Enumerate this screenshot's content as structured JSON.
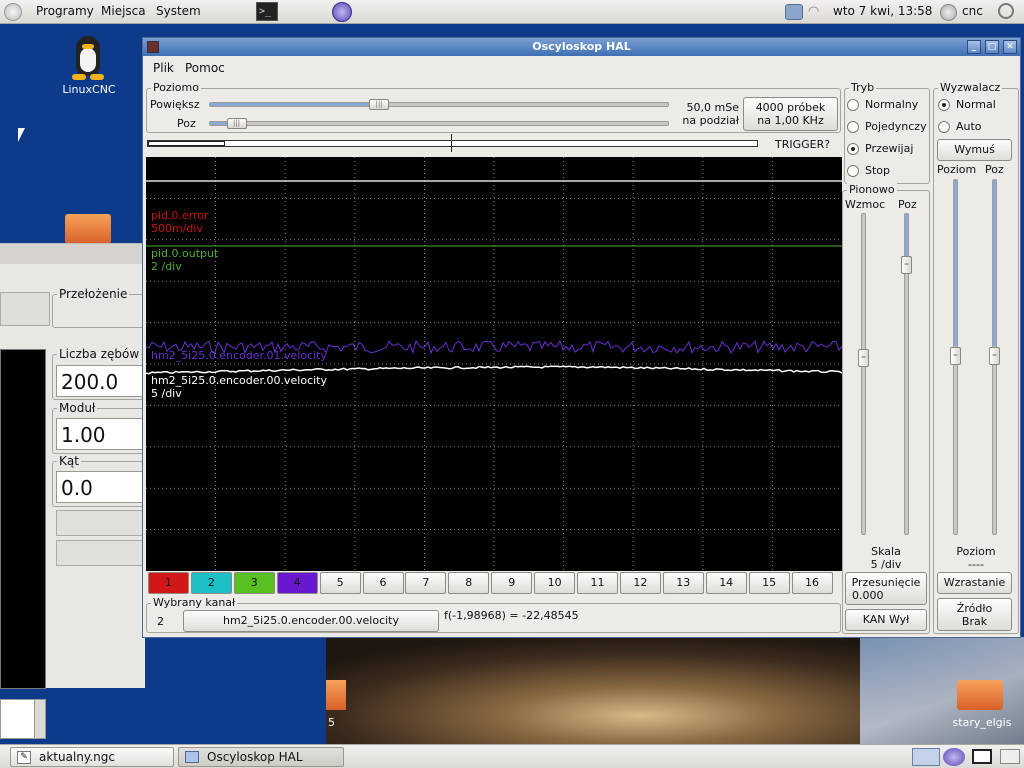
{
  "top_panel": {
    "menu": [
      "Programy",
      "Miejsca",
      "System"
    ],
    "clock": "wto  7 kwi, 13:58",
    "user": "cnc"
  },
  "desktop": {
    "icons": [
      {
        "label": "LinuxCNC",
        "icon": "linuxcnc-tux-icon"
      },
      {
        "label": "stary_elgis",
        "icon": "folder-icon"
      },
      {
        "label": "5",
        "icon": "folder-icon"
      }
    ]
  },
  "background_window": {
    "frames": {
      "przelozenie": "Przełożenie",
      "liczba_zebow": "Liczba zębów",
      "modul": "Moduł",
      "kat": "Kąt"
    },
    "values": {
      "liczba_zebow": "200.0",
      "modul": "1.00",
      "kat": "0.0"
    }
  },
  "window": {
    "title": "Oscyloskop HAL",
    "menu": [
      "Plik",
      "Pomoc"
    ],
    "horizontal": {
      "frame_label": "Poziomo",
      "zoom_label": "Powiększ",
      "pos_label": "Poz",
      "time_div_line1": "50,0 mSe",
      "time_div_line2": "na podział",
      "samples_line1": "4000 próbek",
      "samples_line2": "na 1,00 KHz",
      "trigger_label": "TRIGGER?",
      "zoom_level": 0.37,
      "pos_level": 0.06
    },
    "mode": {
      "frame_label": "Tryb",
      "options": [
        "Normalny",
        "Pojedynczy",
        "Przewijaj",
        "Stop"
      ],
      "selected": "Przewijaj"
    },
    "trigger": {
      "frame_label": "Wyzwalacz",
      "options": [
        "Normal",
        "Auto"
      ],
      "selected": "Normal",
      "force_label": "Wymuś",
      "level_label": "Poziom",
      "pos_label": "Poz",
      "level_title": "Poziom",
      "level_value": "----",
      "edge_label": "Wzrastanie",
      "source_line1": "Źródło",
      "source_line2": "Brak"
    },
    "vertical": {
      "frame_label": "Pionowo",
      "gain_label": "Wzmoc",
      "pos_label": "Poz",
      "scale_label": "Skala",
      "scale_value": "5 /div",
      "offset_label": "Przesunięcie",
      "offset_value": "0.000",
      "chan_off_label": "KAN Wył",
      "gain_level": 0.55,
      "pos_level": 0.16
    },
    "traces": [
      {
        "name": "pid.0.error",
        "scale": "500m/div",
        "color": "#c81414"
      },
      {
        "name": "pid.0.output",
        "scale": "2 /div",
        "color": "#4caf30"
      },
      {
        "name": "hm2_5i25.0.encoder.01.velocity",
        "scale": "",
        "color": "#6a2fd0"
      },
      {
        "name": "hm2_5i25.0.encoder.00.velocity",
        "scale": "5 /div",
        "color": "#ffffff"
      }
    ],
    "channels": [
      {
        "n": "1",
        "color": "#d01818"
      },
      {
        "n": "2",
        "color": "#1ec0c8"
      },
      {
        "n": "3",
        "color": "#58c020"
      },
      {
        "n": "4",
        "color": "#6a18d0"
      },
      {
        "n": "5",
        "color": ""
      },
      {
        "n": "6",
        "color": ""
      },
      {
        "n": "7",
        "color": ""
      },
      {
        "n": "8",
        "color": ""
      },
      {
        "n": "9",
        "color": ""
      },
      {
        "n": "10",
        "color": ""
      },
      {
        "n": "11",
        "color": ""
      },
      {
        "n": "12",
        "color": ""
      },
      {
        "n": "13",
        "color": ""
      },
      {
        "n": "14",
        "color": ""
      },
      {
        "n": "15",
        "color": ""
      },
      {
        "n": "16",
        "color": ""
      }
    ],
    "selected_channel": {
      "frame_label": "Wybrany kanał",
      "number": "2",
      "signal": "hm2_5i25.0.encoder.00.velocity",
      "readout": "f(-1,98968) = -22,48545"
    }
  },
  "taskbar": {
    "tasks": [
      {
        "label": "aktualny.ngc",
        "icon": "editor-icon"
      },
      {
        "label": "Oscyloskop HAL",
        "icon": "window-icon"
      }
    ]
  }
}
